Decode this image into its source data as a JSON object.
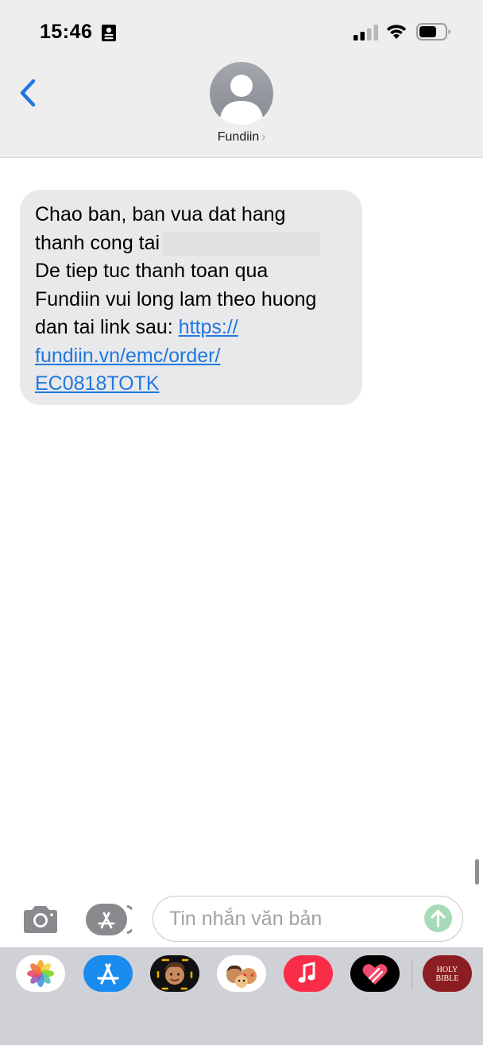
{
  "status_bar": {
    "time": "15:46",
    "icons": [
      "id-card-icon",
      "cellular-signal-icon",
      "wifi-icon",
      "battery-icon"
    ]
  },
  "header": {
    "contact_name": "Fundiin",
    "contact_chevron": "›",
    "back_icon": "chevron-left-icon",
    "avatar_icon": "person-silhouette-icon",
    "background": "#eeeeef"
  },
  "messages": [
    {
      "direction": "incoming",
      "lines": [
        "Chao ban, ban vua dat hang",
        "thanh cong tai",
        "De tiep tuc thanh toan qua",
        "Fundiin vui long lam theo huong",
        "dan tai link sau:"
      ],
      "link_parts": [
        "https://",
        "fundiin.vn/emc/order/",
        "EC0818TOTK"
      ],
      "link_url": "https://fundiin.vn/emc/order/EC0818TOTK",
      "bubble_color": "#e9e9eb",
      "link_color": "#1f78e0"
    }
  ],
  "composer": {
    "placeholder": "Tin nhắn văn bản",
    "value": "",
    "camera_icon": "camera-icon",
    "apps_icon": "app-store-icon",
    "send_icon": "arrow-up-icon",
    "send_color": "#a6dbb8"
  },
  "dock_apps": [
    {
      "name": "photos-app-icon"
    },
    {
      "name": "app-store-app-icon"
    },
    {
      "name": "memoji-stickers-icon"
    },
    {
      "name": "animoji-stickers-icon"
    },
    {
      "name": "music-app-icon"
    },
    {
      "name": "digital-touch-icon"
    },
    {
      "name": "holy-bible-app-icon",
      "label_lines": [
        "HOLY",
        "BIBLE"
      ]
    }
  ]
}
